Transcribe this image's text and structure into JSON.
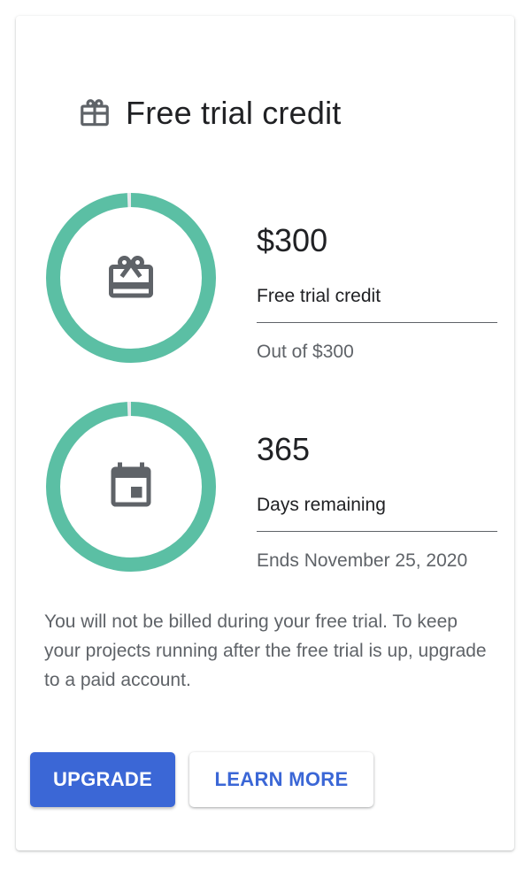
{
  "header": {
    "title": "Free trial credit",
    "icon": "gift-icon"
  },
  "metrics": [
    {
      "value": "$300",
      "label": "Free trial credit",
      "sub": "Out of $300",
      "icon": "credit-card-gift-icon",
      "progress_fraction": 0.995
    },
    {
      "value": "365",
      "label": "Days remaining",
      "sub": "Ends November 25, 2020",
      "icon": "calendar-icon",
      "progress_fraction": 0.995
    }
  ],
  "description": "You will not be billed during your free trial. To keep your projects running after the free trial is up, upgrade to a paid account.",
  "buttons": {
    "upgrade_label": "UPGRADE",
    "learn_more_label": "LEARN MORE"
  },
  "colors": {
    "ring": "#5bbfa4",
    "ring_track": "#e8eaed",
    "primary": "#3b67d6",
    "icon": "#5f6368"
  }
}
